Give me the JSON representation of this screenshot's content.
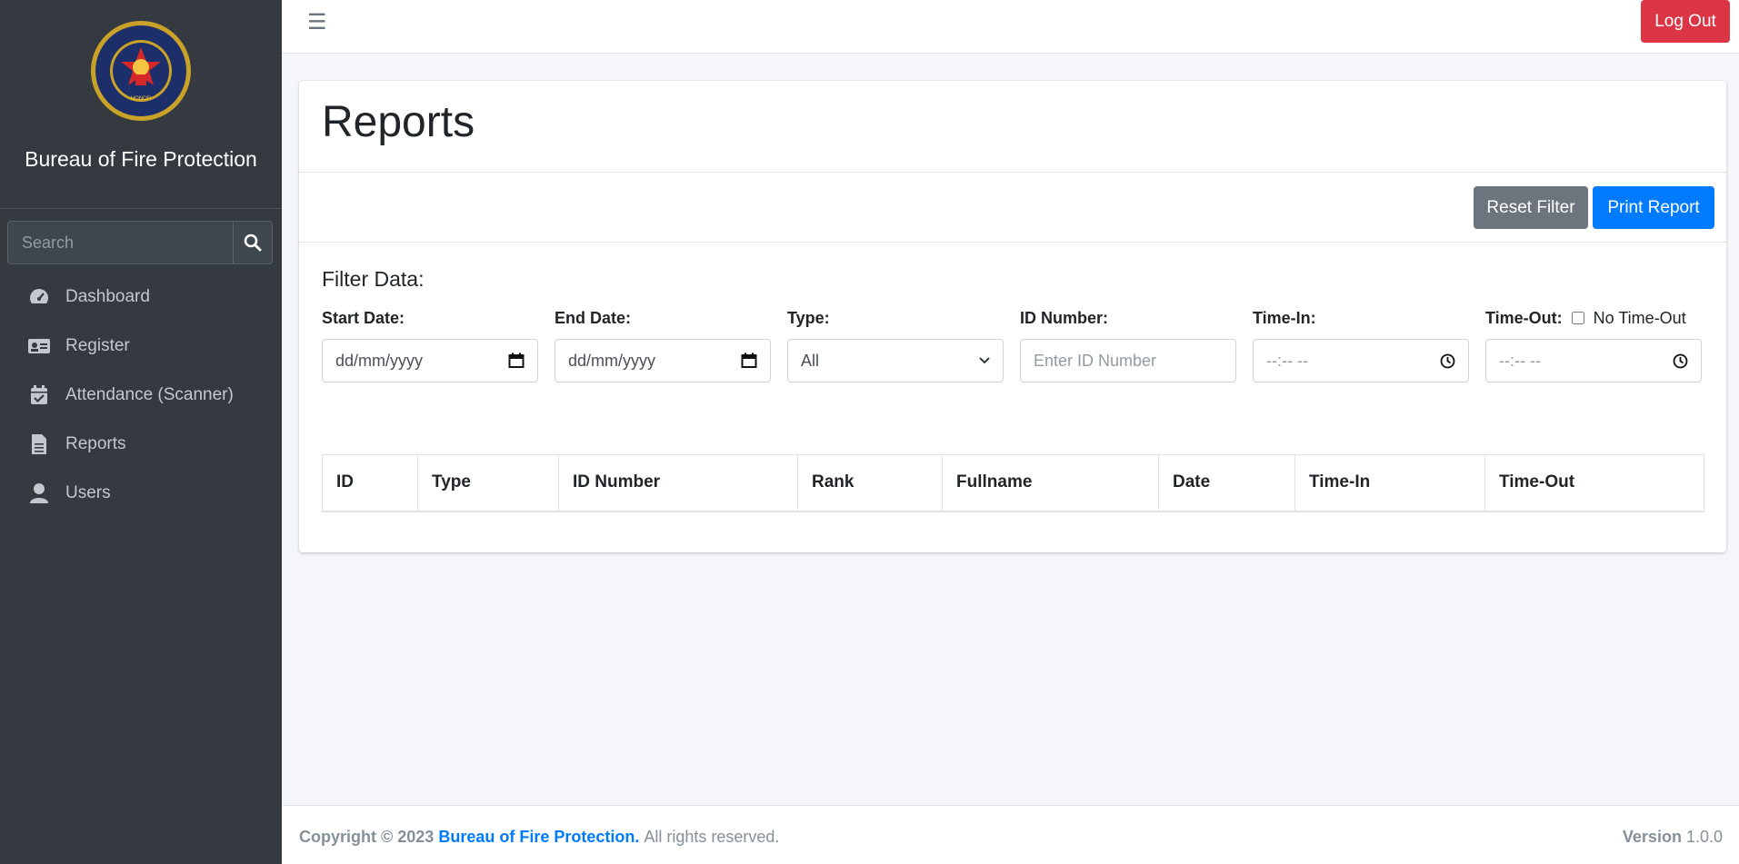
{
  "sidebar": {
    "brand": "Bureau of Fire Protection",
    "search_placeholder": "Search",
    "items": [
      {
        "label": "Dashboard",
        "icon": "dashboard-gauge-icon"
      },
      {
        "label": "Register",
        "icon": "id-card-icon"
      },
      {
        "label": "Attendance (Scanner)",
        "icon": "calendar-check-icon"
      },
      {
        "label": "Reports",
        "icon": "file-text-icon"
      },
      {
        "label": "Users",
        "icon": "user-icon"
      }
    ]
  },
  "topbar": {
    "logout_label": "Log Out"
  },
  "page": {
    "title": "Reports",
    "reset_label": "Reset Filter",
    "print_label": "Print Report",
    "filter_title": "Filter Data:"
  },
  "filters": {
    "start_date": {
      "label": "Start Date:",
      "value": "dd/mm/yyyy"
    },
    "end_date": {
      "label": "End Date:",
      "value": "dd/mm/yyyy"
    },
    "type": {
      "label": "Type:",
      "value": "All"
    },
    "id_number": {
      "label": "ID Number:",
      "placeholder": "Enter ID Number"
    },
    "time_in": {
      "label": "Time-In:",
      "value": "--:-- --"
    },
    "time_out": {
      "label": "Time-Out:",
      "value": "--:-- --",
      "no_timeout_label": "No Time-Out"
    }
  },
  "table": {
    "columns": [
      "ID",
      "Type",
      "ID Number",
      "Rank",
      "Fullname",
      "Date",
      "Time-In",
      "Time-Out"
    ],
    "rows": []
  },
  "footer": {
    "copyright": "Copyright © 2023",
    "org": "Bureau of Fire Protection.",
    "rights": "All rights reserved.",
    "version_label": "Version",
    "version": "1.0.0"
  },
  "colors": {
    "sidebar_bg": "#343a40",
    "primary": "#007bff",
    "danger": "#dc3545",
    "secondary": "#6c757d"
  }
}
